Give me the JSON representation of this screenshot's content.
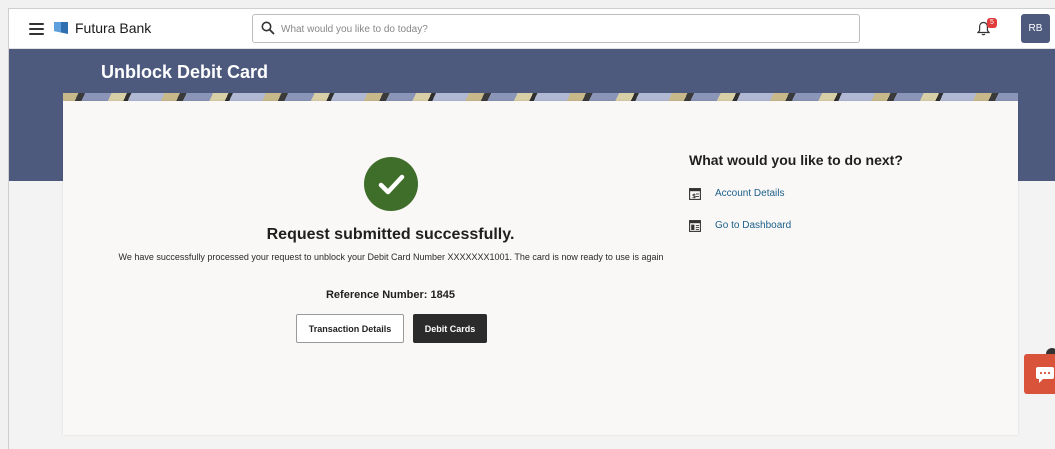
{
  "header": {
    "brand_name": "Futura Bank",
    "search_placeholder": "What would you like to do today?",
    "notification_count": "5",
    "avatar_initials": "RB"
  },
  "page": {
    "title": "Unblock Debit Card"
  },
  "confirmation": {
    "title": "Request submitted successfully.",
    "message": "We have successfully processed your request to unblock your Debit Card Number XXXXXXX1001. The card is now ready to use is again",
    "reference": "Reference Number: 1845",
    "transaction_details_label": "Transaction Details",
    "debit_cards_label": "Debit Cards"
  },
  "next_actions": {
    "title": "What would you like to do next?",
    "items": [
      {
        "label": "Account Details",
        "icon": "account-details-icon"
      },
      {
        "label": "Go to Dashboard",
        "icon": "dashboard-icon"
      }
    ]
  },
  "colors": {
    "accent": "#4d5a7e",
    "success": "#3f6d2a",
    "link": "#1c5f8a",
    "chat": "#d9533a",
    "badge": "#e03b3b"
  }
}
